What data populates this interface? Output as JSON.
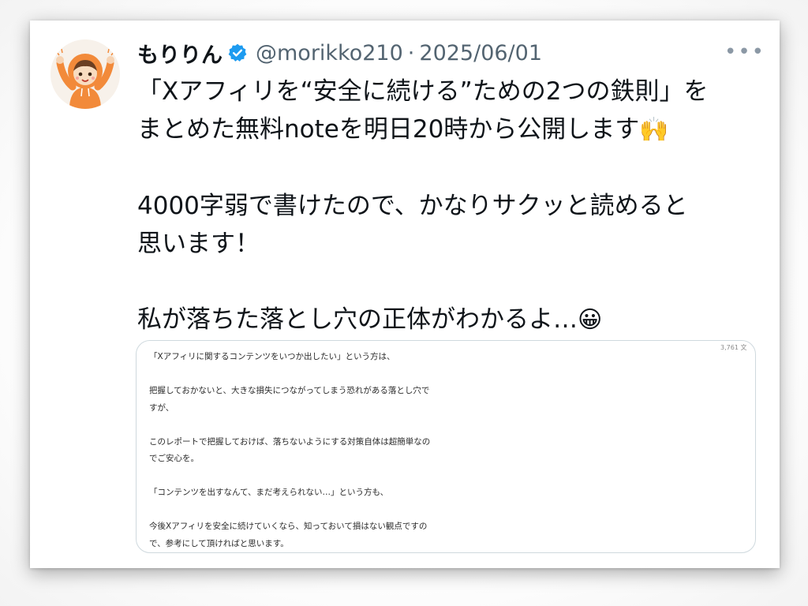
{
  "tweet": {
    "display_name": "もりりん",
    "handle": "@morikko210",
    "separator": "·",
    "date": "2025/06/01",
    "more_label": "•••",
    "lines": {
      "l1": "「Xアフィリを“安全に続ける”ための2つの鉄則」を",
      "l2": "まとめた無料noteを明日20時から公開します",
      "l2_emoji": "🙌",
      "l3": "4000字弱で書けたので、かなりサクッと読めると",
      "l4": "思います！",
      "l5": "私が落ちた落とし穴の正体がわかるよ…",
      "l5_emoji": "😀"
    }
  },
  "media": {
    "word_count": "3,761 文",
    "lines": {
      "m1": "「Xアフィリに関するコンテンツをいつか出したい」という方は、",
      "m2": "把握しておかないと、大きな損失につながってしまう恐れがある落とし穴で",
      "m3": "すが、",
      "m4": "このレポートで把握しておけば、落ちないようにする対策自体は超簡単なの",
      "m5": "でご安心を。",
      "m6": "「コンテンツを出すなんて、まだ考えられない…」という方も、",
      "m7": "今後Xアフィリを安全に続けていくなら、知っておいて損はない観点ですの",
      "m8": "で、参考にして頂ければと思います。"
    }
  },
  "colors": {
    "verified_blue": "#1d9bf0",
    "avatar_hoodie": "#f28a3a",
    "text_primary": "#0f1419",
    "text_secondary": "#536471"
  },
  "icons": {
    "verified": "verified-badge-icon",
    "more": "more-options-icon"
  }
}
